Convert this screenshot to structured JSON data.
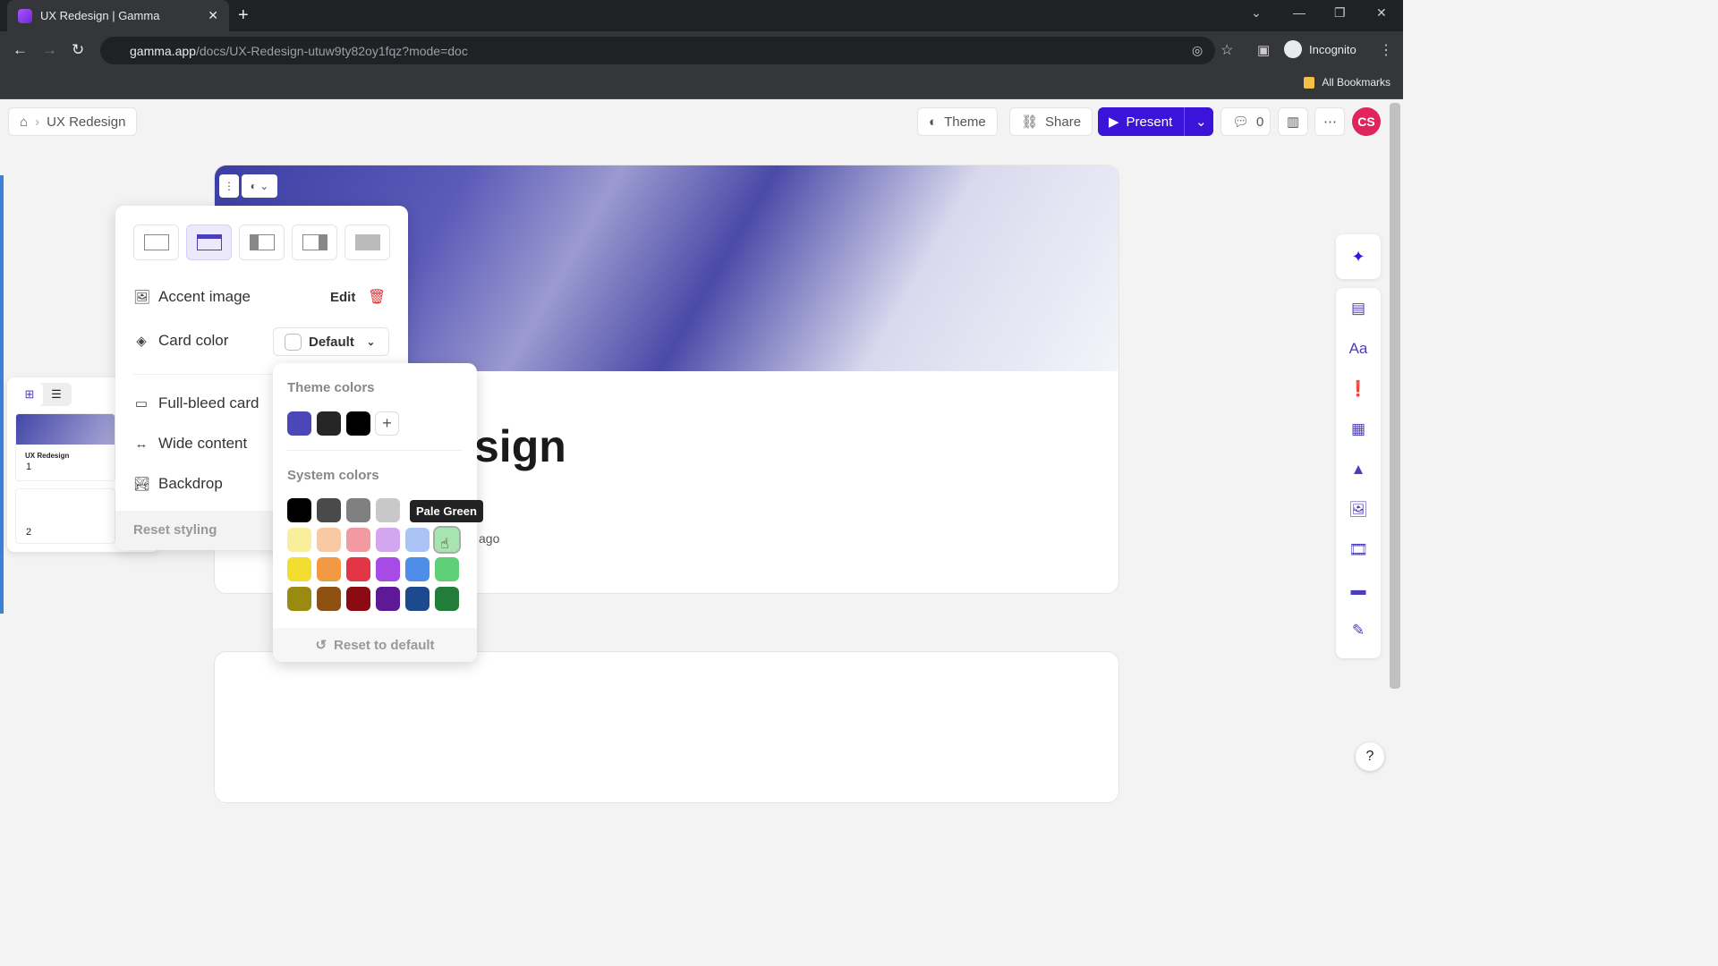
{
  "browser": {
    "tab_title": "UX Redesign | Gamma",
    "url_host": "gamma.app",
    "url_path": "/docs/UX-Redesign-utuw9ty82oy1fqz?mode=doc",
    "profile": "Incognito",
    "bookmarks": "All Bookmarks"
  },
  "header": {
    "breadcrumb": "UX Redesign",
    "theme": "Theme",
    "share": "Share",
    "present": "Present",
    "comments": "0",
    "avatar": "CS"
  },
  "doc": {
    "title": "UX Redesign",
    "title_visible": "sign",
    "subtitle_visible": "ago"
  },
  "thumbnails": [
    {
      "num": "1",
      "title": "UX Redesign"
    },
    {
      "num": "2",
      "title": ""
    }
  ],
  "panel": {
    "accent_image": "Accent image",
    "edit": "Edit",
    "card_color": "Card color",
    "card_color_value": "Default",
    "full_bleed": "Full-bleed card",
    "wide": "Wide content",
    "backdrop": "Backdrop",
    "reset": "Reset styling"
  },
  "color_picker": {
    "theme_label": "Theme colors",
    "theme_colors": [
      "#4b47b9",
      "#262626",
      "#000000"
    ],
    "system_label": "System colors",
    "system_colors": [
      [
        "#000000",
        "#4a4a4a",
        "#808080",
        "#c8c8c8",
        "#ffffff",
        "#ffffff"
      ],
      [
        "#f9ee9c",
        "#f9c9a4",
        "#f29aa2",
        "#d5a6f0",
        "#a9c4f5",
        "#a8e4b0"
      ],
      [
        "#f2dc2f",
        "#f29a43",
        "#e23545",
        "#a64be6",
        "#4f8ee8",
        "#5fcf78"
      ],
      [
        "#9a8a10",
        "#8f5013",
        "#8c0a14",
        "#5e1a96",
        "#1d4a8c",
        "#237d3a"
      ]
    ],
    "tooltip": "Pale Green",
    "reset_default": "Reset to default"
  }
}
